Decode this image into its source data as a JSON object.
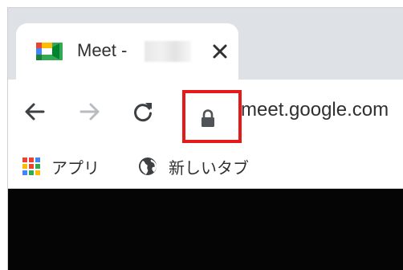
{
  "tab": {
    "title": "Meet - ",
    "close_glyph": "✕",
    "favicon": "google-meet-icon"
  },
  "toolbar": {
    "back_icon": "arrow-left-icon",
    "forward_icon": "arrow-right-icon",
    "reload_icon": "reload-icon"
  },
  "omnibox": {
    "url": "meet.google.com",
    "lock_icon": "lock-icon",
    "highlight_color": "#e51b1b"
  },
  "bookmarks": {
    "items": [
      {
        "label": "アプリ",
        "icon": "apps-grid-icon"
      },
      {
        "label": "新しいタブ",
        "icon": "globe-icon"
      }
    ]
  },
  "colors": {
    "tabstrip": "#dee1e6",
    "content": "#050505"
  }
}
